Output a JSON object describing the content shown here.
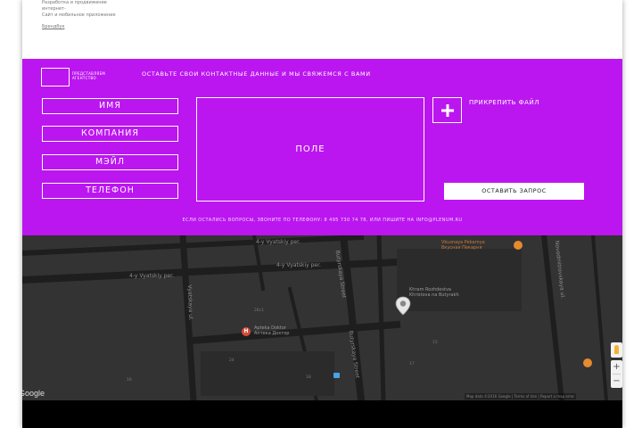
{
  "top": {
    "link_lines": [
      "Разработка и продвижение",
      "интернет-",
      "Сайт и мобильное приложение"
    ],
    "footer_link": "Брендбук"
  },
  "contact": {
    "logo_text_1": "ПРЕДСТАВЛЯЕМ",
    "logo_text_2": "АГЕНТСТВО",
    "headline": "ОСТАВЬТЕ СВОИ КОНТАКТНЫЕ ДАННЫЕ И МЫ СВЯЖЕМСЯ С ВАМИ",
    "fields": {
      "name": "ИМЯ",
      "company": "КОМПАНИЯ",
      "email": "МЭЙЛ",
      "phone": "ТЕЛЕФОН"
    },
    "message_placeholder": "ПОЛЕ",
    "attach_label": "ПРИКРЕПИТЬ ФАЙЛ",
    "submit_label": "ОСТАВИТЬ ЗАПРОС",
    "footnote": "ЕСЛИ ОСТАЛИСЬ ВОПРОСЫ, ЗВОНИТЕ ПО ТЕЛЕФОНУ: 8 495 730 74 78, ИЛИ ПИШИТЕ НА INFO@PLENUM.RU",
    "accent_color": "#bb16f0"
  },
  "map": {
    "streets": {
      "s1": "4-y Vyatskiy per.",
      "s2": "4-y Vyatskiy per.",
      "s3": "4-y Vyatskiy per.",
      "s4": "Vyatskaya ul.",
      "s5": "Butyrskaya Street",
      "s6": "Butyrskaya Street",
      "s7": "Novodmitrovskaya ul."
    },
    "pois": {
      "p1": "Vkusnaya Pekarnya",
      "p1b": "Вкусная Пекарня",
      "p2": "Khram Rozhdestva",
      "p2b": "Khristova na Butyrakh",
      "p3": "Apteka Doktor",
      "p3b": "Аптека Доктор"
    },
    "numbers": {
      "n1": "26с1",
      "n2": "24",
      "n3": "16",
      "n4": "18",
      "n5": "15",
      "n6": "17"
    },
    "google": "Google",
    "attribution": "Map data ©2016 Google | Terms of Use | Report a map error",
    "zoom_in": "+",
    "zoom_out": "−"
  }
}
